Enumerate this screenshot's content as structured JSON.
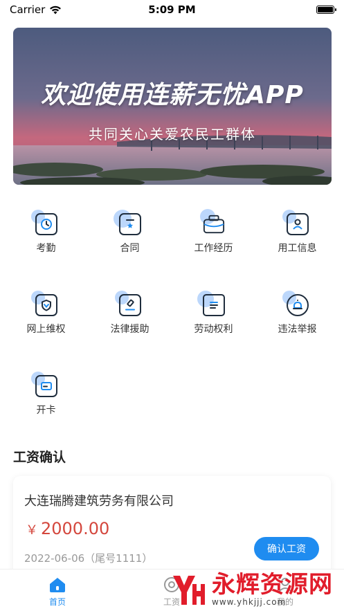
{
  "status_bar": {
    "carrier": "Carrier",
    "time": "5:09 PM",
    "battery_level": 1.0
  },
  "banner": {
    "title": "欢迎使用连薪无忧APP",
    "subtitle": "共同关心关爱农民工群体"
  },
  "menu": [
    {
      "label": "考勤",
      "icon": "clock-icon"
    },
    {
      "label": "合同",
      "icon": "contract-icon"
    },
    {
      "label": "工作经历",
      "icon": "briefcase-icon"
    },
    {
      "label": "用工信息",
      "icon": "user-card-icon"
    },
    {
      "label": "网上维权",
      "icon": "shield-icon"
    },
    {
      "label": "法律援助",
      "icon": "gavel-icon"
    },
    {
      "label": "劳动权利",
      "icon": "document-icon"
    },
    {
      "label": "违法举报",
      "icon": "alarm-icon"
    },
    {
      "label": "开卡",
      "icon": "card-icon"
    }
  ],
  "wage_section": {
    "title": "工资确认",
    "card": {
      "company": "大连瑞腾建筑劳务有限公司",
      "currency": "￥",
      "amount": "2000.00",
      "date": "2022-06-06（尾号1111）",
      "button": "确认工资"
    }
  },
  "tabbar": {
    "items": [
      {
        "label": "首页",
        "icon": "home-icon",
        "active": true
      },
      {
        "label": "工资",
        "icon": "wage-icon",
        "active": false
      },
      {
        "label": "我的",
        "icon": "profile-icon",
        "active": false
      }
    ]
  },
  "watermark": {
    "title": "永辉资源网",
    "url": "www.yhkjjj.com"
  },
  "colors": {
    "accent": "#1f8cf0",
    "amount": "#d4473d",
    "icon_blob": "#bcd7fb"
  }
}
